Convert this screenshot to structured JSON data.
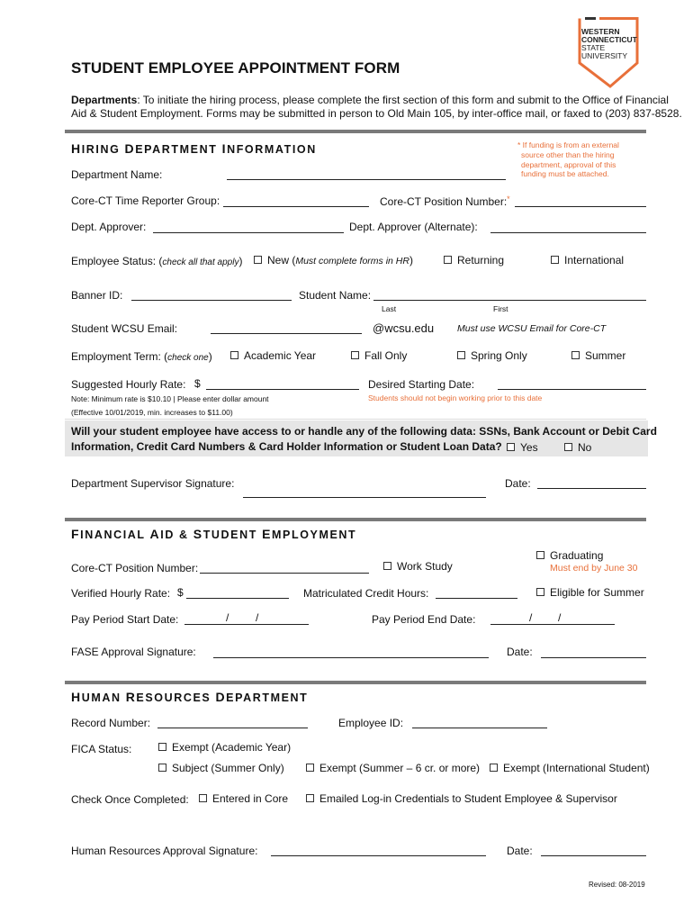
{
  "logo": {
    "line1": "WESTERN",
    "line2": "CONNECTICUT",
    "line3": "STATE",
    "line4": "UNIVERSITY",
    "accent_color": "#e8703a"
  },
  "title": "STUDENT EMPLOYEE APPOINTMENT FORM",
  "intro": {
    "lead": "Departments",
    "line1": ": To initiate the hiring process, please complete the first section of this form and submit to the Office of Financial",
    "line2": "Aid & Student Employment. Forms may be submitted in person to Old Main 105, by inter-office mail, or faxed to (203) 837-8528."
  },
  "hiring": {
    "section_title": {
      "h1": "H",
      "r1": "IRING ",
      "h2": "D",
      "r2": "EPARTMENT ",
      "h3": "I",
      "r3": "NFORMATION"
    },
    "funding_note": [
      "* If funding is from an external",
      "source other than the hiring",
      "department, approval of this",
      "funding must be attached."
    ],
    "department_name_label": "Department Name:",
    "time_reporter_label": "Core-CT Time Reporter Group:",
    "position_number_label": "Core-CT Position Number:",
    "asterisk": "*",
    "dept_approver_label": "Dept. Approver:",
    "dept_approver_alt_label": "Dept. Approver (Alternate):",
    "employee_status": {
      "label": "Employee Status: (",
      "label_italic": "check all that apply",
      "label_end": ")",
      "options": {
        "new_prefix": "New (",
        "new_italic": "Must complete forms in HR",
        "new_suffix": ")",
        "returning": "Returning",
        "international": "International"
      }
    },
    "banner_id_label": "Banner ID:",
    "student_name_label": "Student Name:",
    "name_last": "Last",
    "name_first": "First",
    "email_label": "Student WCSU Email:",
    "email_domain": "@wcsu.edu",
    "email_note": "Must use WCSU Email for Core-CT",
    "employment_term": {
      "label": "Employment Term: (",
      "label_italic": "check one",
      "label_end": ")",
      "options": [
        "Academic Year",
        "Fall Only",
        "Spring Only",
        "Summer"
      ]
    },
    "hourly_rate_label": "Suggested Hourly Rate:",
    "dollar": "$",
    "start_date_label": "Desired Starting Date:",
    "rate_note": "Note: Minimum rate is $10.10  |  Please enter dollar amount",
    "rate_note2": "(Effective 10/01/2019, min. increases to $11.00)",
    "start_note": "Students should not begin working prior to this date",
    "data_question_line1": "Will your student employee have access to or handle any of the following data: SSNs, Bank Account or Debit Card",
    "data_question_line2": "Information, Credit Card Numbers & Card Holder Information or Student Loan Data?",
    "yes_label": "Yes",
    "no_label": "No",
    "supervisor_signature_label": "Department Supervisor Signature:",
    "date_label": "Date:"
  },
  "financial": {
    "section_title": {
      "h1": "F",
      "r1": "INANCIAL ",
      "h2": "A",
      "r2": "ID & ",
      "h3": "S",
      "r3": "TUDENT ",
      "h4": "E",
      "r4": "MPLOYMENT"
    },
    "position_number_label": "Core-CT Position Number:",
    "work_study": "Work Study",
    "graduating": "Graduating",
    "graduating_note": "Must end by June 30",
    "verified_rate_label": "Verified Hourly Rate:",
    "dollar": "$",
    "credit_hours_label": "Matriculated Credit Hours:",
    "eligible_summer": "Eligible for Summer",
    "pay_start_label": "Pay Period Start Date:",
    "pay_end_label": "Pay Period End Date:",
    "slash": "/",
    "fase_signature_label": "FASE Approval Signature:",
    "date_label": "Date:"
  },
  "hr": {
    "section_title": {
      "h1": "H",
      "r1": "UMAN ",
      "h2": "R",
      "r2": "ESOURCES ",
      "h3": "D",
      "r3": "EPARTMENT"
    },
    "record_number_label": "Record Number:",
    "employee_id_label": "Employee ID:",
    "fica_label": "FICA Status:",
    "fica_options": [
      "Exempt (Academic Year)",
      "Subject (Summer Only)",
      "Exempt (Summer – 6 cr. or more)",
      "Exempt (International Student)"
    ],
    "check_completed_label": "Check Once Completed:",
    "completed_options": [
      "Entered in Core",
      "Emailed Log-in Credentials to Student Employee & Supervisor"
    ],
    "hr_signature_label": "Human Resources Approval Signature:",
    "date_label": "Date:"
  },
  "revised": "Revised:  08-2019"
}
